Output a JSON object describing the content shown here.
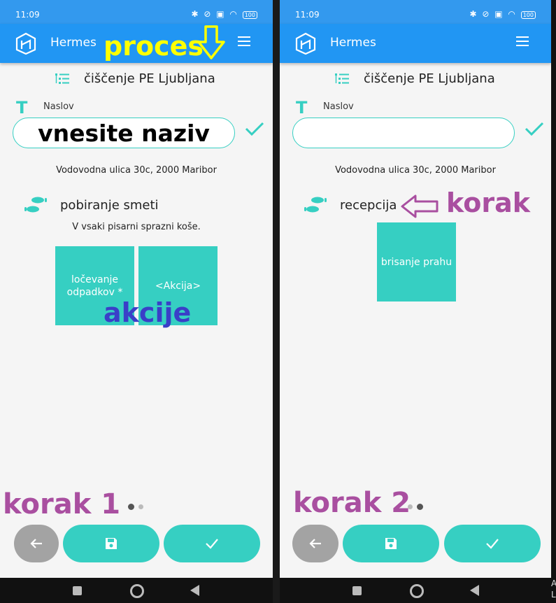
{
  "colors": {
    "primary": "#2196f3",
    "accent": "#36cfc2",
    "back_button": "#a3a3a3",
    "annotation_yellow": "#ffff00",
    "annotation_purple": "#a94fa0",
    "annotation_blue": "#3a3fc8"
  },
  "screens": [
    {
      "status": {
        "time": "11:09",
        "battery": "100"
      },
      "app_title": "Hermes",
      "process_name": "čiščenje PE Ljubljana",
      "title_label": "Naslov",
      "title_value": "vnesite naziv",
      "address": "Vodovodna ulica 30c, 2000 Maribor",
      "step": {
        "name": "pobiranje smeti",
        "description": "V vsaki pisarni sprazni koše."
      },
      "actions": [
        {
          "label": "ločevanje odpadkov *"
        },
        {
          "label": "<Akcija>"
        }
      ],
      "page_indicator": {
        "current": 1,
        "total": 2
      },
      "buttons": {
        "back": "arrow-left-icon",
        "save": "save-icon",
        "confirm": "check-icon"
      }
    },
    {
      "status": {
        "time": "11:09",
        "battery": "100"
      },
      "app_title": "Hermes",
      "process_name": "čiščenje PE Ljubljana",
      "title_label": "Naslov",
      "title_value": "",
      "address": "Vodovodna ulica 30c, 2000 Maribor",
      "step": {
        "name": "recepcija"
      },
      "actions": [
        {
          "label": "brisanje prahu"
        }
      ],
      "page_indicator": {
        "current": 2,
        "total": 2
      },
      "buttons": {
        "back": "arrow-left-icon",
        "save": "save-icon",
        "confirm": "check-icon"
      }
    }
  ],
  "annotations": {
    "proces": "proces",
    "akcije": "akcije",
    "korak": "korak",
    "korak1": "korak 1",
    "korak2": "korak 2"
  },
  "edge_text": "A\nL"
}
